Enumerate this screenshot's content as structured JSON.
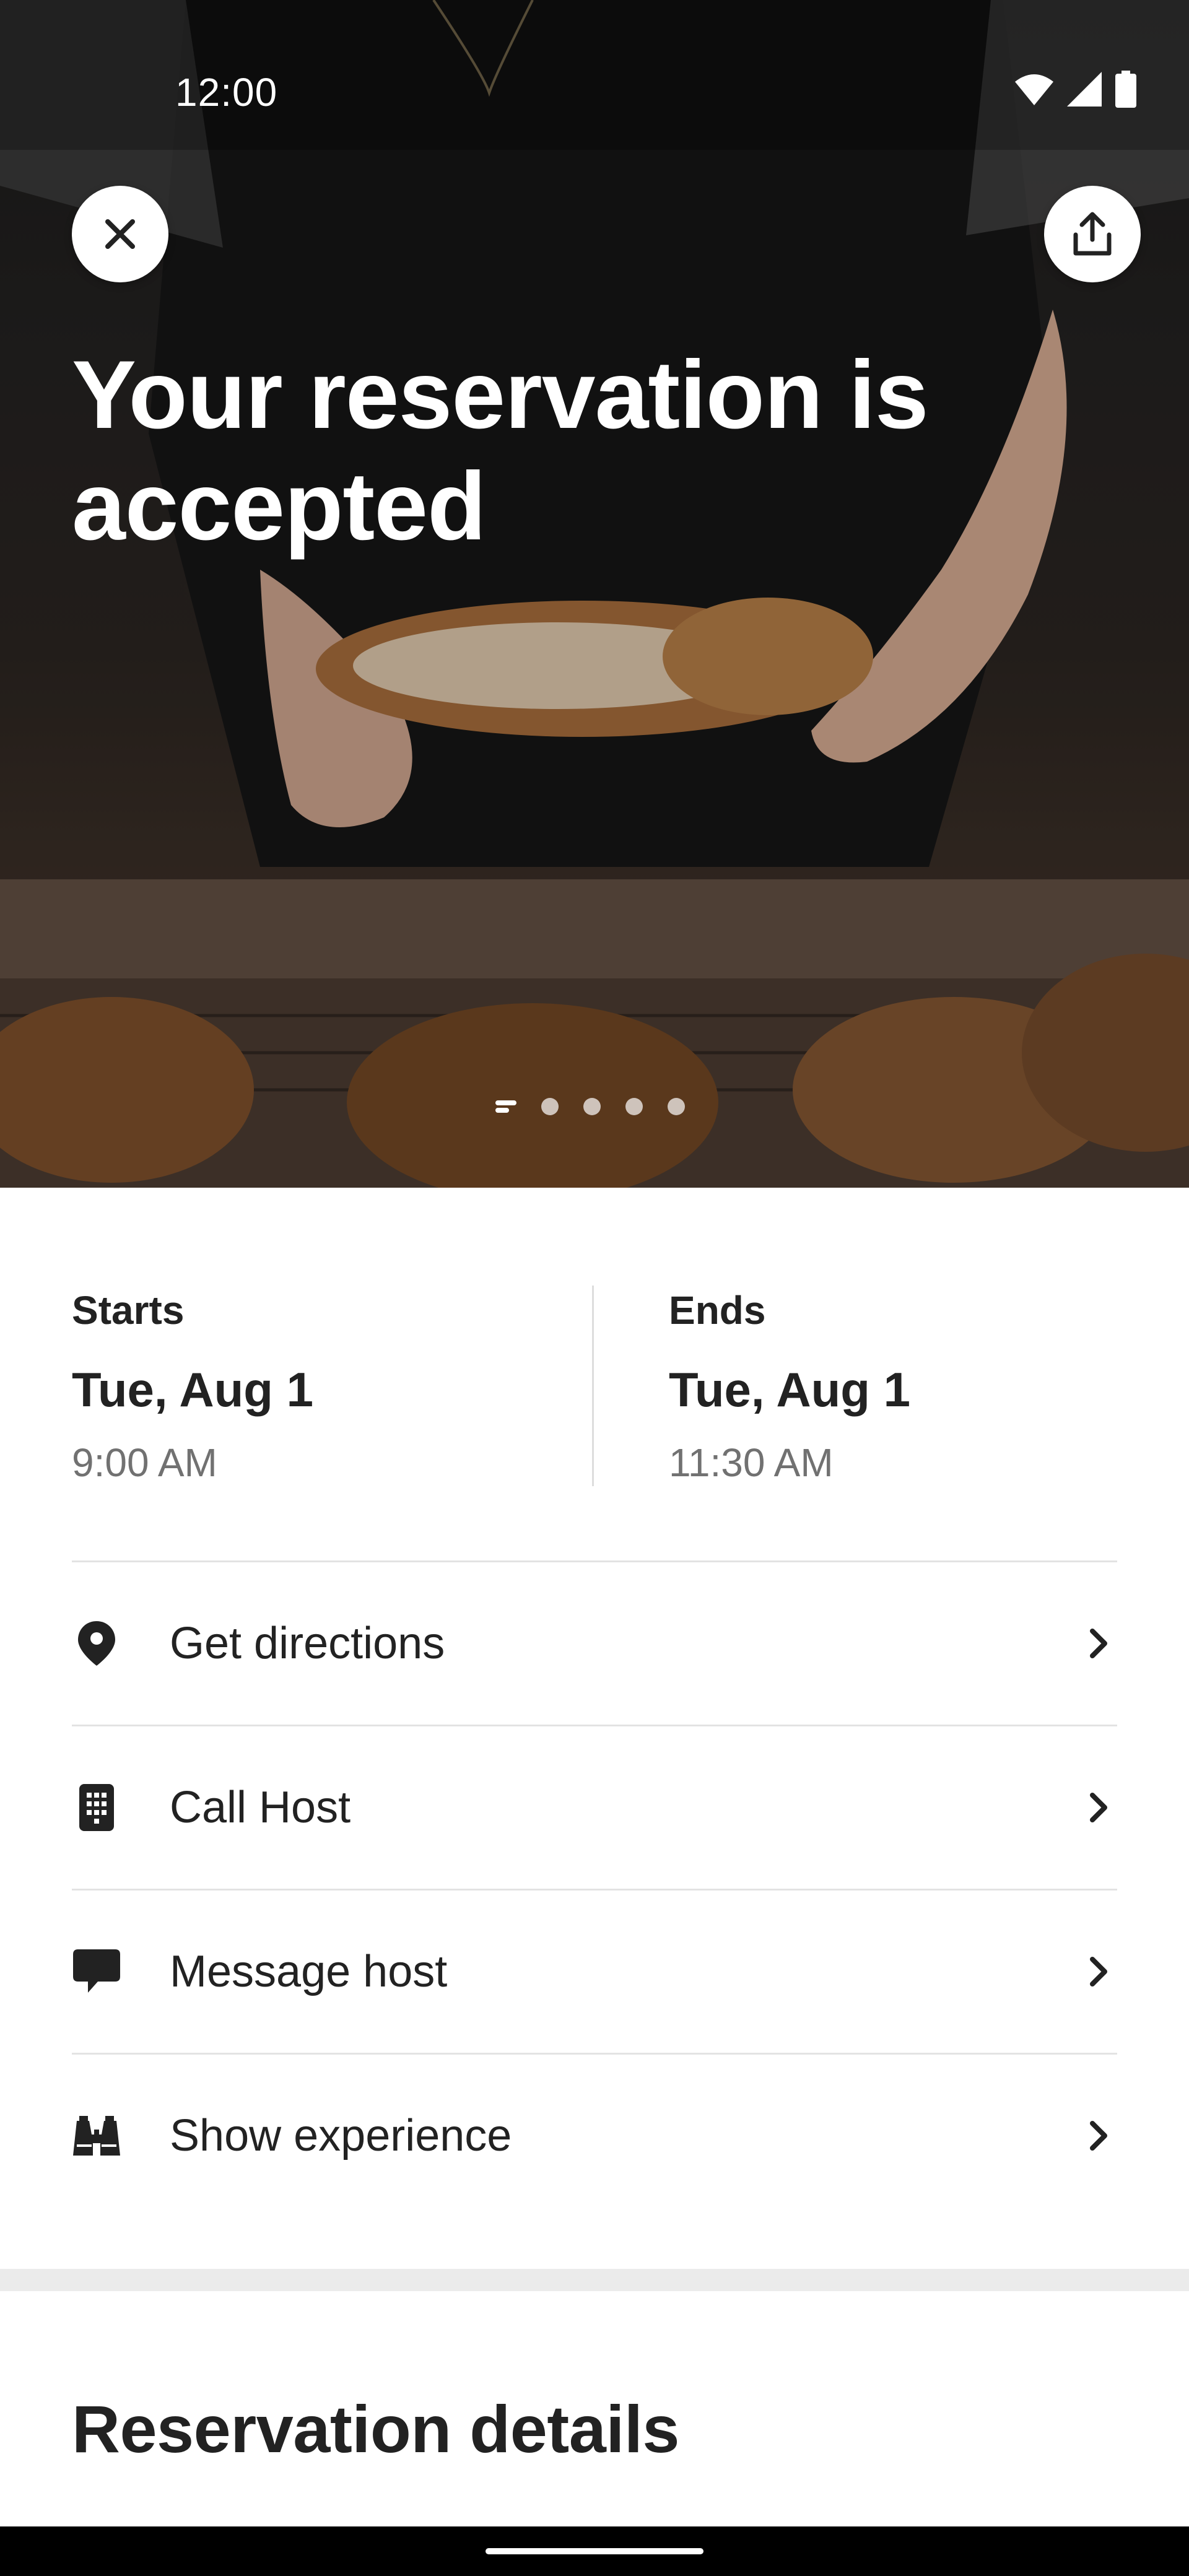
{
  "status_bar": {
    "time": "12:00"
  },
  "hero": {
    "title": "Your reservation is accepted",
    "photo_count": 5,
    "active_photo": 1
  },
  "schedule": {
    "start": {
      "label": "Starts",
      "date": "Tue, Aug 1",
      "time": "9:00 AM"
    },
    "end": {
      "label": "Ends",
      "date": "Tue, Aug 1",
      "time": "11:30 AM"
    }
  },
  "actions": [
    {
      "label": "Get directions",
      "icon": "location-pin-icon"
    },
    {
      "label": "Call Host",
      "icon": "phone-icon"
    },
    {
      "label": "Message host",
      "icon": "message-icon"
    },
    {
      "label": "Show experience",
      "icon": "binoculars-icon"
    }
  ],
  "section": {
    "title": "Reservation details"
  },
  "colors": {
    "text": "#222222",
    "muted": "#717171",
    "divider": "#e3e3e3",
    "band": "#ebebeb"
  }
}
